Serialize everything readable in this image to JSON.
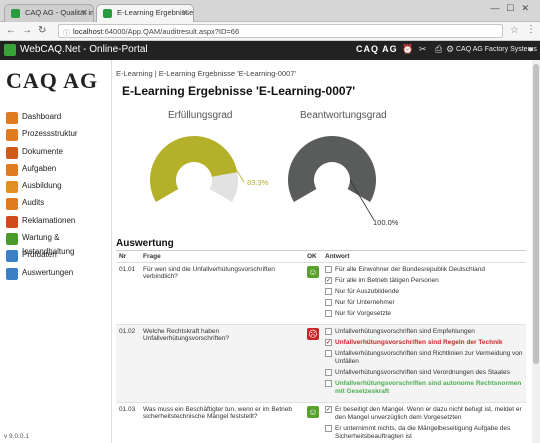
{
  "browser": {
    "tabs": [
      {
        "label": "CAQ AG - Qualität im Fo"
      },
      {
        "label": "E-Learning Ergebnisse '"
      }
    ],
    "url_host": "localhost",
    "url_rest": ":64000/App.QAM/auditresult.aspx?ID=66"
  },
  "header": {
    "title": "WebCAQ.Net - Online-Portal",
    "brand": "CAQ AG",
    "user": "CAQ AG Factory Systems"
  },
  "sidebar": {
    "logo": "CAQ AG",
    "items": [
      {
        "label": "Dashboard",
        "color": "#e07b20"
      },
      {
        "label": "Prozessstruktur",
        "color": "#e07b20"
      },
      {
        "label": "Dokumente",
        "color": "#d05a1a"
      },
      {
        "label": "Aufgaben",
        "color": "#e07b20"
      },
      {
        "label": "Ausbildung",
        "color": "#e09020"
      },
      {
        "label": "Audits",
        "color": "#e07b20"
      },
      {
        "label": "Reklamationen",
        "color": "#d04a1a"
      },
      {
        "label": "Wartung & Instandhaltung",
        "color": "#4a9a2a"
      },
      {
        "label": "Prüfdaten",
        "color": "#3b7fc4"
      },
      {
        "label": "Auswertungen",
        "color": "#3b7fc4"
      }
    ],
    "version": "v 9.0.0.1"
  },
  "content": {
    "breadcrumb": "E-Learning | E-Learning Ergebnisse 'E-Learning-0007'",
    "title": "E-Learning Ergebnisse 'E-Learning-0007'",
    "section": "Auswertung"
  },
  "colors": {
    "olive": "#b5b02a",
    "gray": "#5a5c5c",
    "light": "#e2e2e2"
  },
  "chart_data": [
    {
      "type": "pie",
      "title": "Erfüllungsgrad",
      "slices": [
        {
          "label": "83.3%",
          "value": 83.3
        },
        {
          "label": "",
          "value": 16.7
        }
      ],
      "value_label": "83.3%"
    },
    {
      "type": "pie",
      "title": "Beantwortungsgrad",
      "slices": [
        {
          "label": "100.0%",
          "value": 100
        }
      ],
      "value_label": "100.0%"
    }
  ],
  "table": {
    "headers": [
      "Nr",
      "Frage",
      "OK",
      "Antwort"
    ],
    "rows": [
      {
        "nr": "01.01",
        "question": "Für wen sind die Unfallverhütungsvorschriften verbindlich?",
        "ok": "good",
        "answers": [
          {
            "text": "Für alle Einwohner der Bundesrepublik Deutschland",
            "checked": false,
            "state": "normal"
          },
          {
            "text": "Für alle im Betrieb tätigen Personen",
            "checked": true,
            "state": "normal"
          },
          {
            "text": "Nur für Auszubildende",
            "checked": false,
            "state": "normal"
          },
          {
            "text": "Nur für Unternehmer",
            "checked": false,
            "state": "normal"
          },
          {
            "text": "Nur für Vorgesetzte",
            "checked": false,
            "state": "normal"
          }
        ]
      },
      {
        "nr": "01.02",
        "question": "Welche Rechtskraft haben Unfallverhütungsvorschriften?",
        "ok": "bad",
        "answers": [
          {
            "text": "Unfallverhütungsvorschriften sind Empfehlungen",
            "checked": false,
            "state": "normal"
          },
          {
            "text": "Unfallverhütungsvorschriften sind Regeln der Technik",
            "checked": true,
            "state": "wrong"
          },
          {
            "text": "Unfallverhütungsvorschriften sind Richtlinien zur Vermeidung von Unfällen",
            "checked": false,
            "state": "normal"
          },
          {
            "text": "Unfallverhütungsvorschriften sind Verordnungen des Staates",
            "checked": false,
            "state": "normal"
          },
          {
            "text": "Unfallverhütungsvorschriften sind autonome Rechtsnormen mit Gesetzeskraft",
            "checked": false,
            "state": "right"
          }
        ]
      },
      {
        "nr": "01.03",
        "question": "Was muss ein Beschäftigter tun, wenn er im Betrieb sicherheitstechnische Mängel feststellt?",
        "ok": "good",
        "answers": [
          {
            "text": "Er beseitigt den Mangel. Wenn er dazu nicht befugt ist, meldet er den Mangel unverzüglich dem Vorgesetzten",
            "checked": true,
            "state": "normal"
          },
          {
            "text": "Er unternimmt nichts, da die Mängelbeseitigung Aufgabe des Sicherheitsbeauftragten ist",
            "checked": false,
            "state": "normal"
          }
        ]
      }
    ]
  }
}
